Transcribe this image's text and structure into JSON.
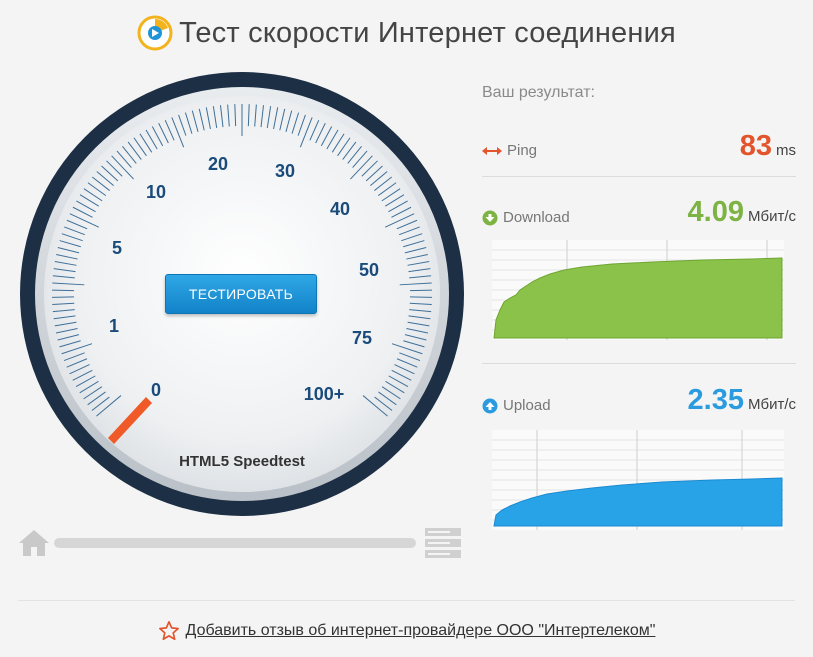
{
  "title": "Тест скорости Интернет соединения",
  "gauge": {
    "labels": [
      "0",
      "1",
      "5",
      "10",
      "20",
      "30",
      "40",
      "50",
      "75",
      "100+"
    ],
    "needle_value": "0",
    "brand": "HTML5 Speedtest",
    "button_label": "ТЕСТИРОВАТЬ"
  },
  "progress": {
    "fraction": 0.0
  },
  "results": {
    "title": "Ваш результат:",
    "ping": {
      "label": "Ping",
      "value": "83",
      "unit": "ms",
      "color": "#e2542b",
      "icon": "arrows-horizontal-icon"
    },
    "download": {
      "label": "Download",
      "value": "4.09",
      "unit": "Мбит/с",
      "color": "#7cb342",
      "icon": "arrow-down-circle-icon"
    },
    "upload": {
      "label": "Upload",
      "value": "2.35",
      "unit": "Мбит/с",
      "color": "#2b9be0",
      "icon": "arrow-up-circle-icon"
    }
  },
  "footer": {
    "link_text": "Добавить отзыв об интернет-провайдере ООО \"Интертелеком\"",
    "icon": "star-outline-icon"
  },
  "colors": {
    "accent": "#1a8fd6",
    "needle": "#f05a28",
    "download": "#8bc34a",
    "upload": "#29a3e8"
  }
}
